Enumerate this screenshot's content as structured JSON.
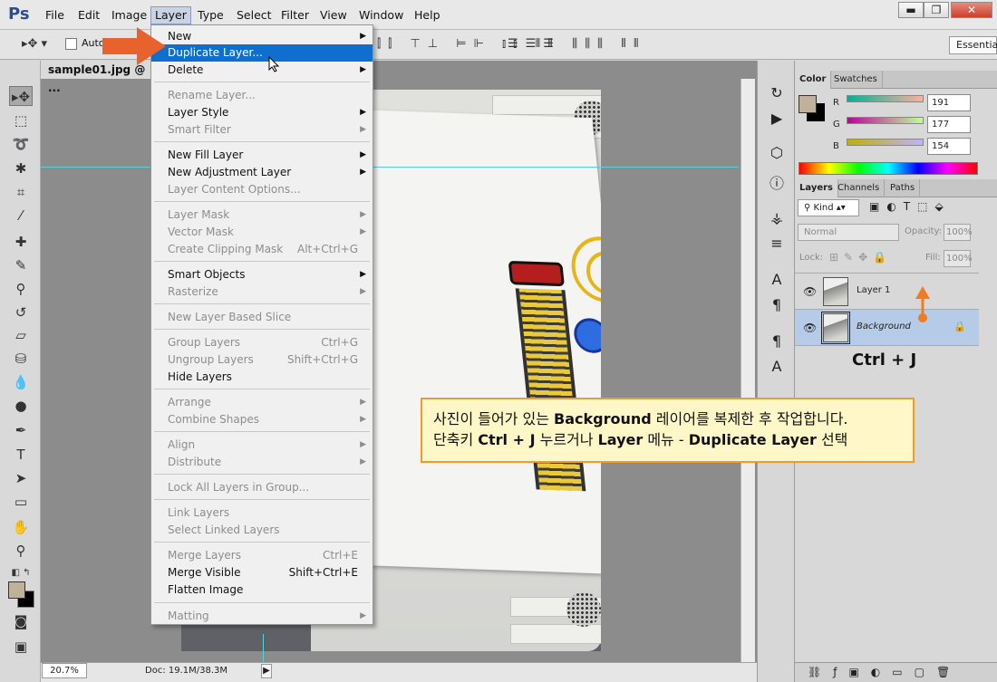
{
  "app": {
    "logo": "Ps"
  },
  "menubar": {
    "items": [
      "File",
      "Edit",
      "Image",
      "Layer",
      "Type",
      "Select",
      "Filter",
      "View",
      "Window",
      "Help"
    ],
    "window_buttons": [
      "▬",
      "❐",
      "✕"
    ]
  },
  "options_bar": {
    "auto_select_label": "Auto-Select:",
    "workspace": "Essentials"
  },
  "document": {
    "tab_title": "sample01.jpg @ ...",
    "zoom": "20.7%",
    "doc_size": "Doc: 19.1M/38.3M"
  },
  "layer_menu": {
    "items": [
      {
        "label": "New",
        "submenu": true
      },
      {
        "label": "Duplicate Layer...",
        "highlighted": true
      },
      {
        "label": "Delete",
        "submenu": true
      },
      {
        "label": "Rename Layer...",
        "disabled": true
      },
      {
        "label": "Layer Style",
        "submenu": true
      },
      {
        "label": "Smart Filter",
        "disabled": true,
        "submenu": true
      },
      {
        "label": "New Fill Layer",
        "submenu": true
      },
      {
        "label": "New Adjustment Layer",
        "submenu": true
      },
      {
        "label": "Layer Content Options...",
        "disabled": true
      },
      {
        "label": "Layer Mask",
        "disabled": true,
        "submenu": true
      },
      {
        "label": "Vector Mask",
        "disabled": true,
        "submenu": true
      },
      {
        "label": "Create Clipping Mask",
        "disabled": true,
        "shortcut": "Alt+Ctrl+G"
      },
      {
        "label": "Smart Objects",
        "submenu": true
      },
      {
        "label": "Rasterize",
        "disabled": true,
        "submenu": true
      },
      {
        "label": "New Layer Based Slice",
        "disabled": true
      },
      {
        "label": "Group Layers",
        "disabled": true,
        "shortcut": "Ctrl+G"
      },
      {
        "label": "Ungroup Layers",
        "disabled": true,
        "shortcut": "Shift+Ctrl+G"
      },
      {
        "label": "Hide Layers"
      },
      {
        "label": "Arrange",
        "disabled": true,
        "submenu": true
      },
      {
        "label": "Combine Shapes",
        "disabled": true,
        "submenu": true
      },
      {
        "label": "Align",
        "disabled": true,
        "submenu": true
      },
      {
        "label": "Distribute",
        "disabled": true,
        "submenu": true
      },
      {
        "label": "Lock All Layers in Group...",
        "disabled": true
      },
      {
        "label": "Link Layers",
        "disabled": true
      },
      {
        "label": "Select Linked Layers",
        "disabled": true
      },
      {
        "label": "Merge Layers",
        "disabled": true,
        "shortcut": "Ctrl+E"
      },
      {
        "label": "Merge Visible",
        "shortcut": "Shift+Ctrl+E"
      },
      {
        "label": "Flatten Image"
      },
      {
        "label": "Matting",
        "disabled": true,
        "submenu": true
      }
    ]
  },
  "color_panel": {
    "tabs": [
      "Color",
      "Swatches"
    ],
    "r_label": "R",
    "g_label": "G",
    "b_label": "B",
    "r": "191",
    "g": "177",
    "b": "154",
    "fg_color": "#bfb19a"
  },
  "layers_panel": {
    "tabs": [
      "Layers",
      "Channels",
      "Paths"
    ],
    "kind_label": "Kind",
    "blend_mode": "Normal",
    "opacity_label": "Opacity:",
    "opacity": "100%",
    "lock_label": "Lock:",
    "fill_label": "Fill:",
    "fill": "100%",
    "layers": [
      {
        "name": "Layer 1",
        "selected": false
      },
      {
        "name": "Background",
        "selected": true,
        "italic": true
      }
    ]
  },
  "annotation": {
    "shortcut": "Ctrl + J",
    "callout_line1_pre": "사진이 들어가 있는 ",
    "callout_line1_bold": "Background",
    "callout_line1_post": "  레이어를 복제한 후 작업합니다.",
    "callout_line2_pre": "단축키 ",
    "callout_line2_bold1": "Ctrl + J",
    "callout_line2_mid": " 누르거나 ",
    "callout_line2_bold2": "Layer",
    "callout_line2_mid2": " 메뉴 - ",
    "callout_line2_bold3": "Duplicate Layer",
    "callout_line2_post": " 선택"
  },
  "colors": {
    "menu_highlight": "#0f6fcf",
    "guide": "#4fd3e0",
    "annotation_arrow": "#e8622e",
    "callout_border": "#ef9b2d",
    "selected_layer": "#b5cbe8"
  }
}
